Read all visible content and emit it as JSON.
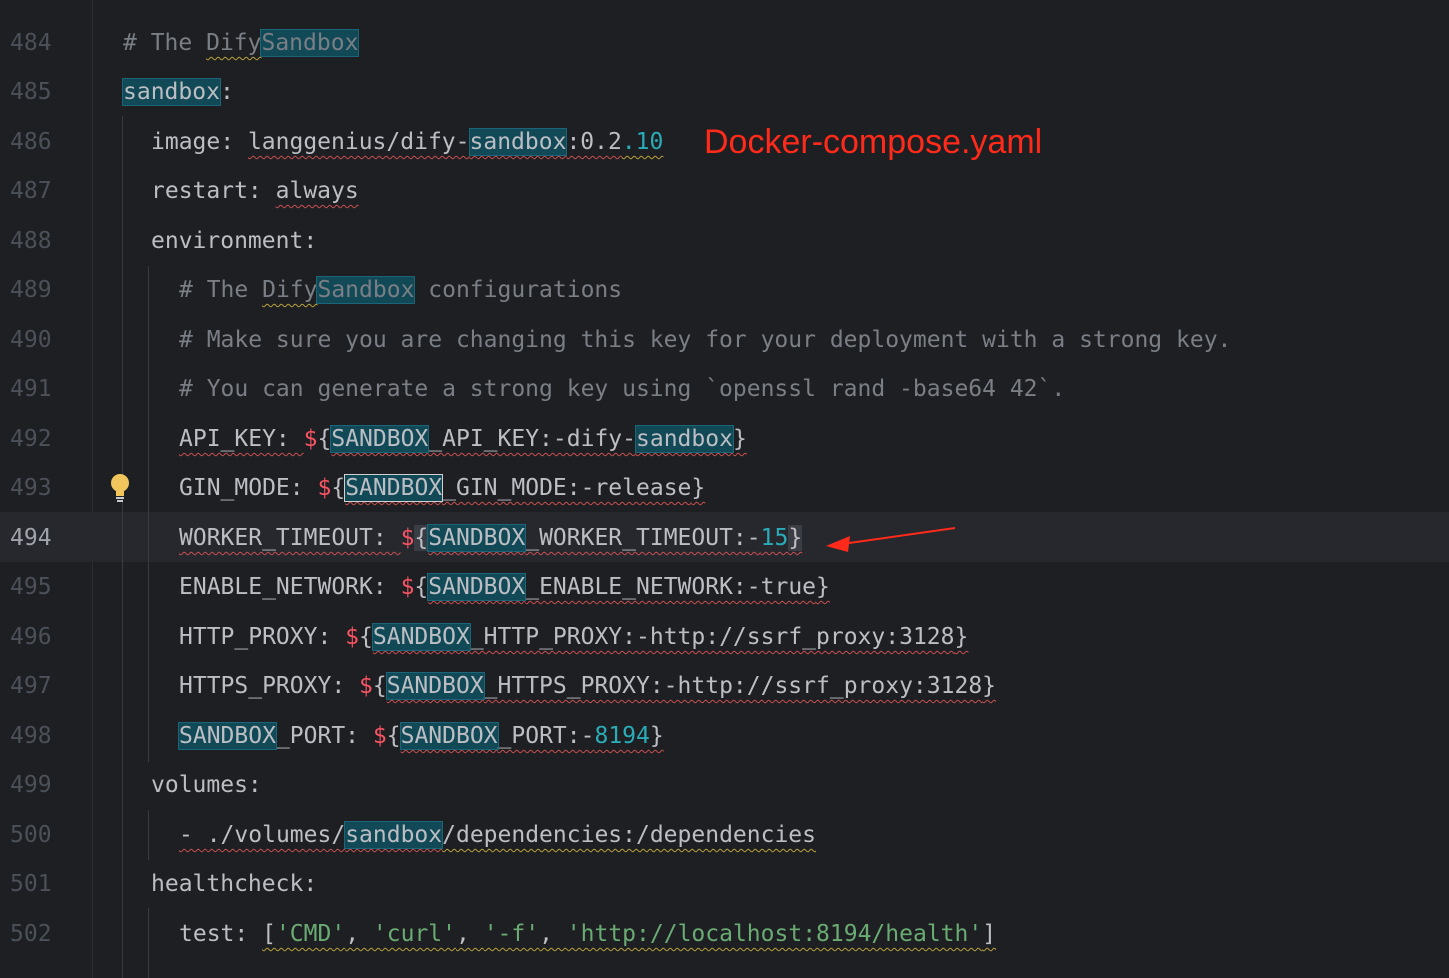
{
  "editor": {
    "annotation": "Docker-compose.yaml",
    "current_line_number": "494",
    "line_numbers": [
      "484",
      "485",
      "486",
      "487",
      "488",
      "489",
      "490",
      "491",
      "492",
      "493",
      "494",
      "495",
      "496",
      "497",
      "498",
      "499",
      "500",
      "501",
      "502"
    ],
    "lines": {
      "l484": [
        "# The ",
        "Dify",
        "Sandbox"
      ],
      "l485": [
        "sandbox",
        ":"
      ],
      "l486": [
        "image: ",
        "langgenius/dify-",
        "sandbox",
        ":0.2",
        ".10"
      ],
      "l487": [
        "restart: ",
        "always"
      ],
      "l488": [
        "environment:"
      ],
      "l489": [
        "# The ",
        "Dify",
        "Sandbox",
        " configurations"
      ],
      "l490": [
        "# Make sure you are changing this key for your deployment with a strong key."
      ],
      "l491": [
        "# You can generate a strong key using `openssl rand -base64 42`."
      ],
      "l492": [
        "API_KEY: ",
        "$",
        "{",
        "SANDBOX",
        "_API_KEY:-dify-",
        "sandbox",
        "}"
      ],
      "l493": [
        "GIN_MODE: ",
        "$",
        "{",
        "SANDBOX",
        "_GIN_MODE:-release",
        "}"
      ],
      "l494": [
        "WORKER_TIMEOUT: ",
        "$",
        "{",
        "SANDBOX",
        "_WORKER_TIMEOUT:-",
        "15",
        "}"
      ],
      "l495": [
        "ENABLE_NETWORK: ",
        "$",
        "{",
        "SANDBOX",
        "_ENABLE_NETWORK:-true",
        "}"
      ],
      "l496": [
        "HTTP_PROXY: ",
        "$",
        "{",
        "SANDBOX",
        "_HTTP_PROXY:-http://ssrf_proxy:3128",
        "}"
      ],
      "l497": [
        "HTTPS_PROXY: ",
        "$",
        "{",
        "SANDBOX",
        "_HTTPS_PROXY:-http://ssrf_proxy:3128",
        "}"
      ],
      "l498": [
        "SANDBOX",
        "_PORT: ",
        "$",
        "{",
        "SANDBOX",
        "_PORT:-",
        "8194",
        "}"
      ],
      "l499": [
        "volumes:"
      ],
      "l500": [
        "- ",
        "./volumes/",
        "sandbox",
        "/dependencies:/dependencies"
      ],
      "l501": [
        "healthcheck:"
      ],
      "l502": [
        "test: ",
        "[",
        "'CMD'",
        ", ",
        "'curl'",
        ", ",
        "'-f'",
        ", ",
        "'http://localhost:8194/health'",
        "]"
      ]
    },
    "icons": {
      "intention_bulb": "lightbulb-icon",
      "annotation_arrow": "arrow-icon"
    },
    "colors": {
      "background": "#1e1f22",
      "comment": "#7a7e85",
      "number": "#2aacb8",
      "string": "#6aab73",
      "dollar": "#f75464",
      "search_highlight": "#114957",
      "annotation": "#ff2a1a"
    }
  }
}
